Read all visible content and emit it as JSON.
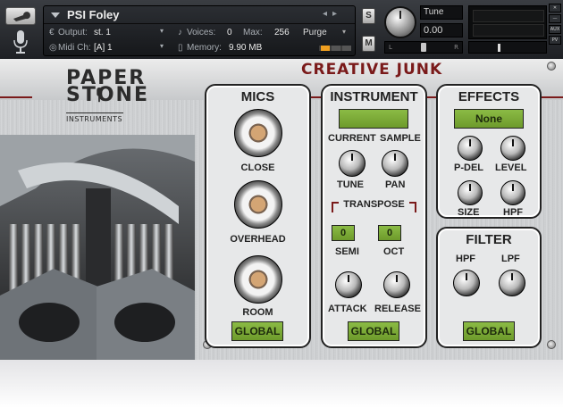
{
  "header": {
    "instrument_name": "PSI Foley",
    "output_label": "Output:",
    "output_value": "st. 1",
    "voices_label": "Voices:",
    "voices_value": "0",
    "max_label": "Max:",
    "max_value": "256",
    "purge_label": "Purge",
    "midi_label": "Midi Ch:",
    "midi_value": "[A] 1",
    "memory_label": "Memory:",
    "memory_value": "9.90 MB",
    "tune_label": "Tune",
    "tune_value": "0.00",
    "solo_label": "S",
    "mute_label": "M",
    "pan_left": "L",
    "pan_right": "R",
    "side_buttons": [
      "AUX",
      "PV"
    ]
  },
  "instrument": {
    "brand_top": "PAPER",
    "brand_bottom": "STONE",
    "brand_sub": "INSTRUMENTS",
    "title": "CREATIVE JUNK"
  },
  "mics": {
    "title": "MICS",
    "close_label": "CLOSE",
    "overhead_label": "OVERHEAD",
    "room_label": "ROOM",
    "global_label": "GLOBAL"
  },
  "instrument_panel": {
    "title": "INSTRUMENT",
    "sample_display": "",
    "current_label": "CURRENT",
    "sample_label": "SAMPLE",
    "tune_label": "TUNE",
    "pan_label": "PAN",
    "transpose_label": "TRANSPOSE",
    "semi_value": "0",
    "oct_value": "0",
    "semi_label": "SEMI",
    "oct_label": "OCT",
    "attack_label": "ATTACK",
    "release_label": "RELEASE",
    "global_label": "GLOBAL"
  },
  "effects": {
    "title": "EFFECTS",
    "selector": "None",
    "pdel_label": "P-DEL",
    "level_label": "LEVEL",
    "size_label": "SIZE",
    "hpf_label": "HPF"
  },
  "filter": {
    "title": "FILTER",
    "hpf_label": "HPF",
    "lpf_label": "LPF",
    "global_label": "GLOBAL"
  }
}
